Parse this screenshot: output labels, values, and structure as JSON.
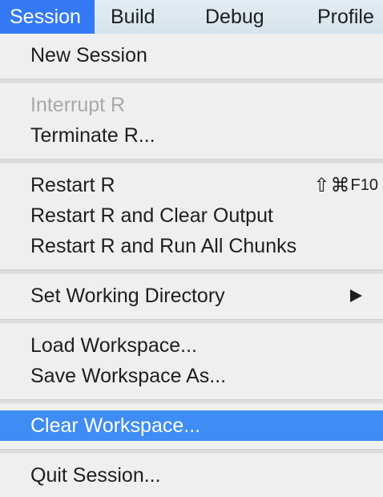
{
  "menubar": {
    "items": [
      {
        "label": "Session"
      },
      {
        "label": "Build"
      },
      {
        "label": "Debug"
      },
      {
        "label": "Profile"
      }
    ]
  },
  "session_menu": {
    "new_session": "New Session",
    "interrupt_r": "Interrupt R",
    "terminate_r": "Terminate R...",
    "restart_r": "Restart R",
    "restart_r_shortcut_symbols": "⇧⌘",
    "restart_r_shortcut_key": "F10",
    "restart_clear_output": "Restart R and Clear Output",
    "restart_run_chunks": "Restart R and Run All Chunks",
    "set_working_directory": "Set Working Directory",
    "load_workspace": "Load Workspace...",
    "save_workspace_as": "Save Workspace As...",
    "clear_workspace": "Clear Workspace...",
    "quit_session": "Quit Session..."
  },
  "colors": {
    "active_menubar": "#3478f6",
    "highlight_item": "#3e8cf4",
    "disabled_text": "#a9a9a9"
  }
}
